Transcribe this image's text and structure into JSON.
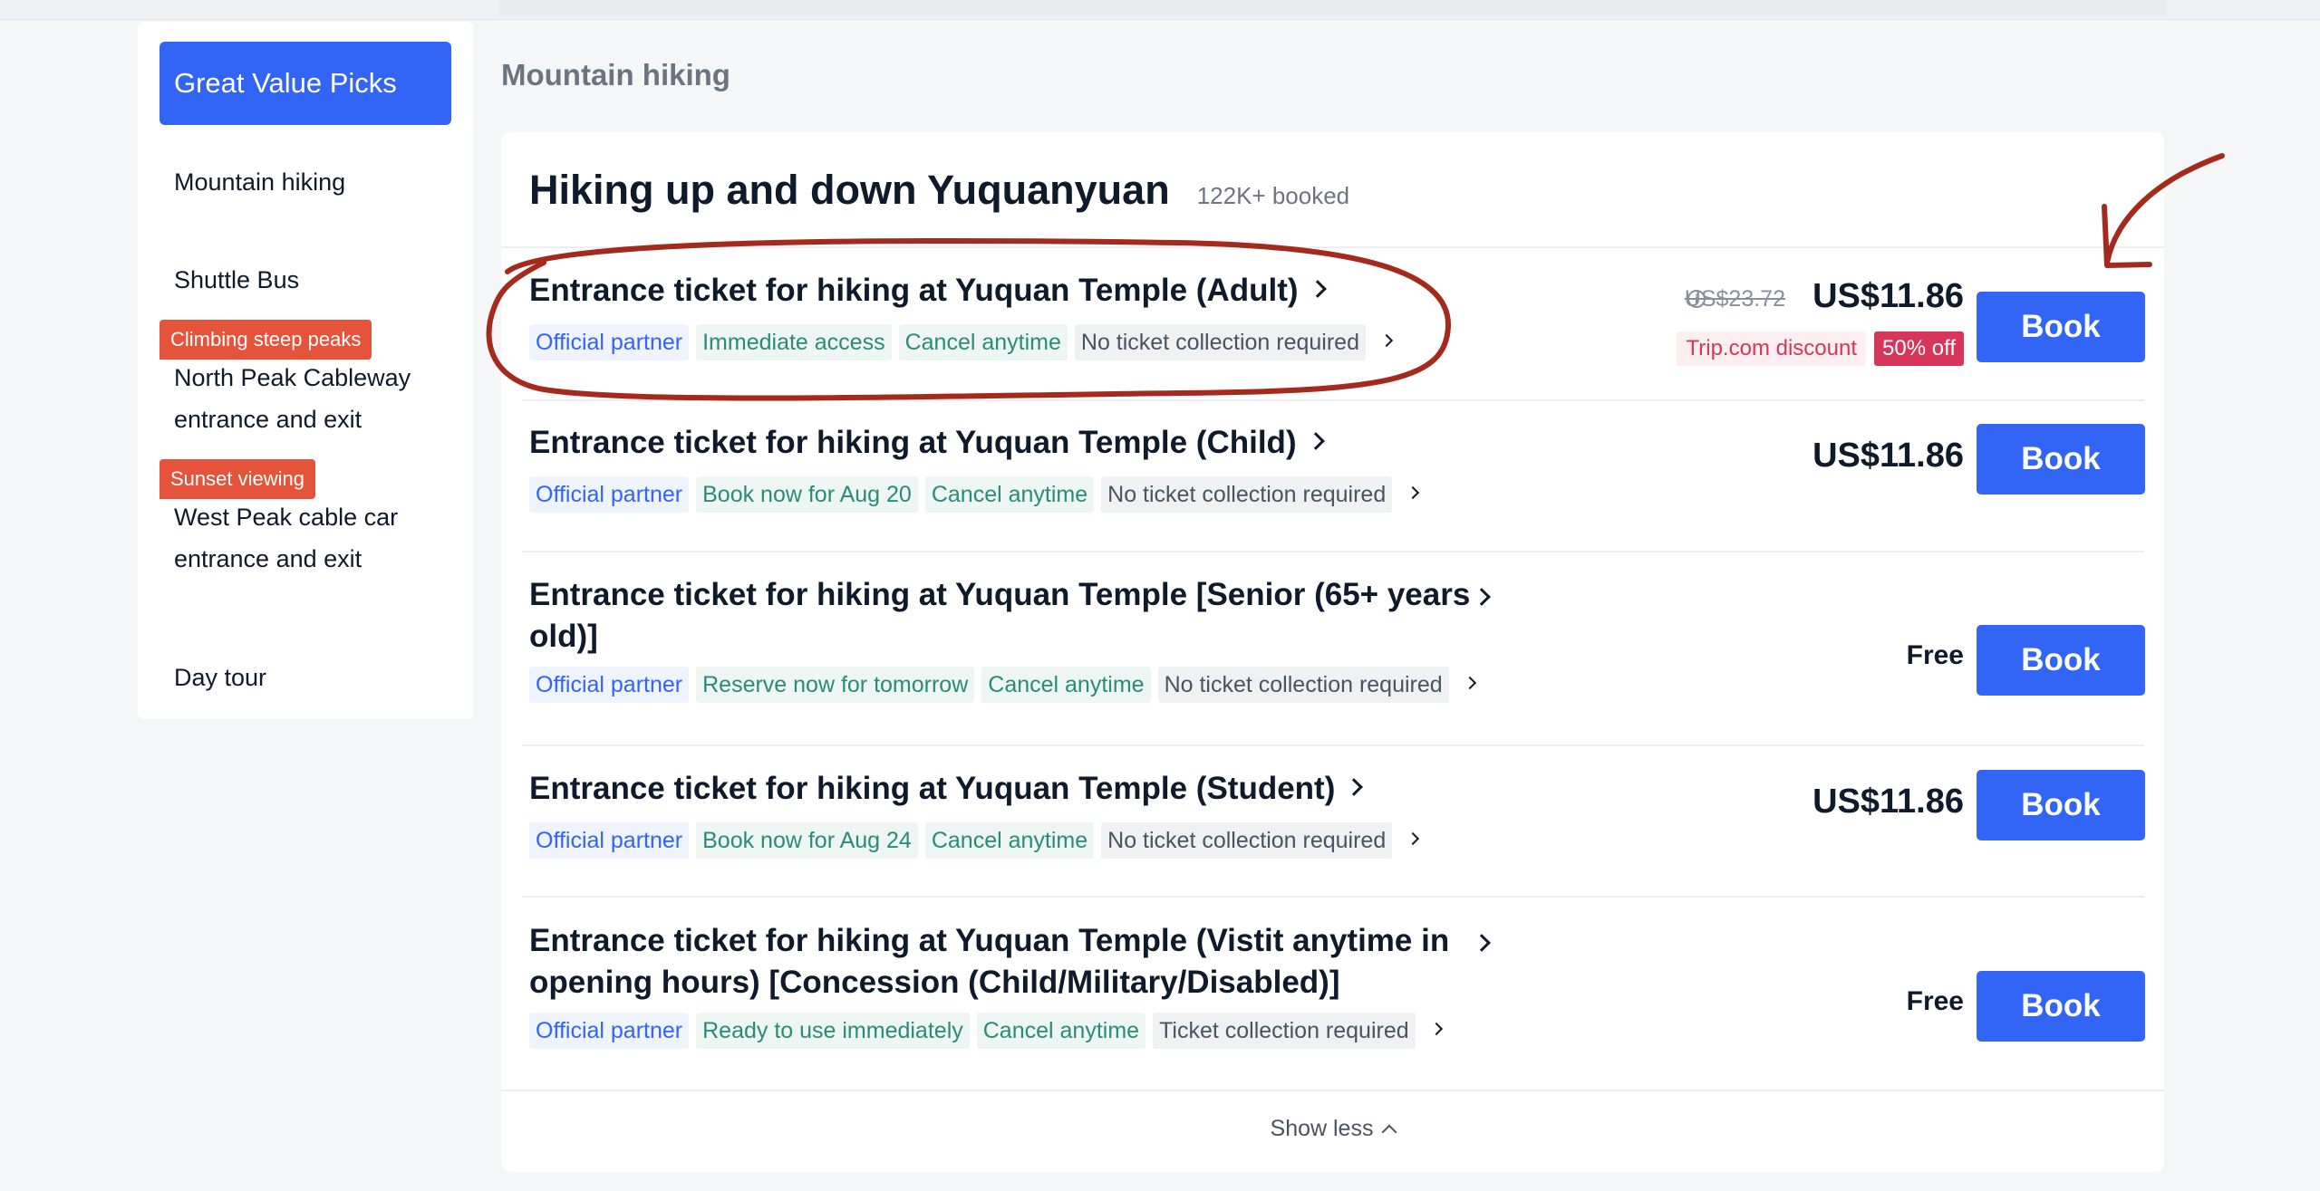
{
  "sidebar": {
    "active_item": "Great Value Picks",
    "items": [
      {
        "label": "Mountain hiking",
        "tag": ""
      },
      {
        "label": "Shuttle Bus",
        "tag": ""
      },
      {
        "label": "North Peak Cableway entrance and exit",
        "tag": "Climbing steep peaks"
      },
      {
        "label": "West Peak cable car entrance and exit",
        "tag": "Sunset viewing"
      },
      {
        "label": "Day tour",
        "tag": ""
      }
    ]
  },
  "section_title": "Mountain hiking",
  "card": {
    "title": "Hiking up and down Yuquanyuan",
    "booked": "122K+ booked"
  },
  "tickets": [
    {
      "title": "Entrance ticket for hiking at Yuquan Temple (Adult)",
      "tags": [
        "Official partner",
        "Immediate access",
        "Cancel anytime",
        "No ticket collection required"
      ],
      "original_price": "US$23.72",
      "price": "US$11.86",
      "discount_label": "Trip.com discount",
      "off_label": "50% off",
      "book_label": "Book"
    },
    {
      "title": "Entrance ticket for hiking at Yuquan Temple (Child)",
      "tags": [
        "Official partner",
        "Book now for Aug 20",
        "Cancel anytime",
        "No ticket collection required"
      ],
      "price": "US$11.86",
      "book_label": "Book"
    },
    {
      "title_line1": "Entrance ticket for hiking at Yuquan Temple [Senior (65+ years",
      "title_line2": "old)]",
      "tags": [
        "Official partner",
        "Reserve now for tomorrow",
        "Cancel anytime",
        "No ticket collection required"
      ],
      "price": "Free",
      "book_label": "Book"
    },
    {
      "title": "Entrance ticket for hiking at Yuquan Temple (Student)",
      "tags": [
        "Official partner",
        "Book now for Aug 24",
        "Cancel anytime",
        "No ticket collection required"
      ],
      "price": "US$11.86",
      "book_label": "Book"
    },
    {
      "title_line1": "Entrance ticket for hiking at Yuquan Temple (Vistit anytime in",
      "title_line2": "opening hours) [Concession (Child/Military/Disabled)]",
      "tags": [
        "Official partner",
        "Ready to use immediately",
        "Cancel anytime",
        "Ticket collection required"
      ],
      "price": "Free",
      "book_label": "Book"
    }
  ],
  "show_less_label": "Show less",
  "colors": {
    "accent": "#3264f5",
    "tag_red": "#e5533b",
    "discount_pink": "#d6365a",
    "annotation_red": "#a52a1e"
  }
}
